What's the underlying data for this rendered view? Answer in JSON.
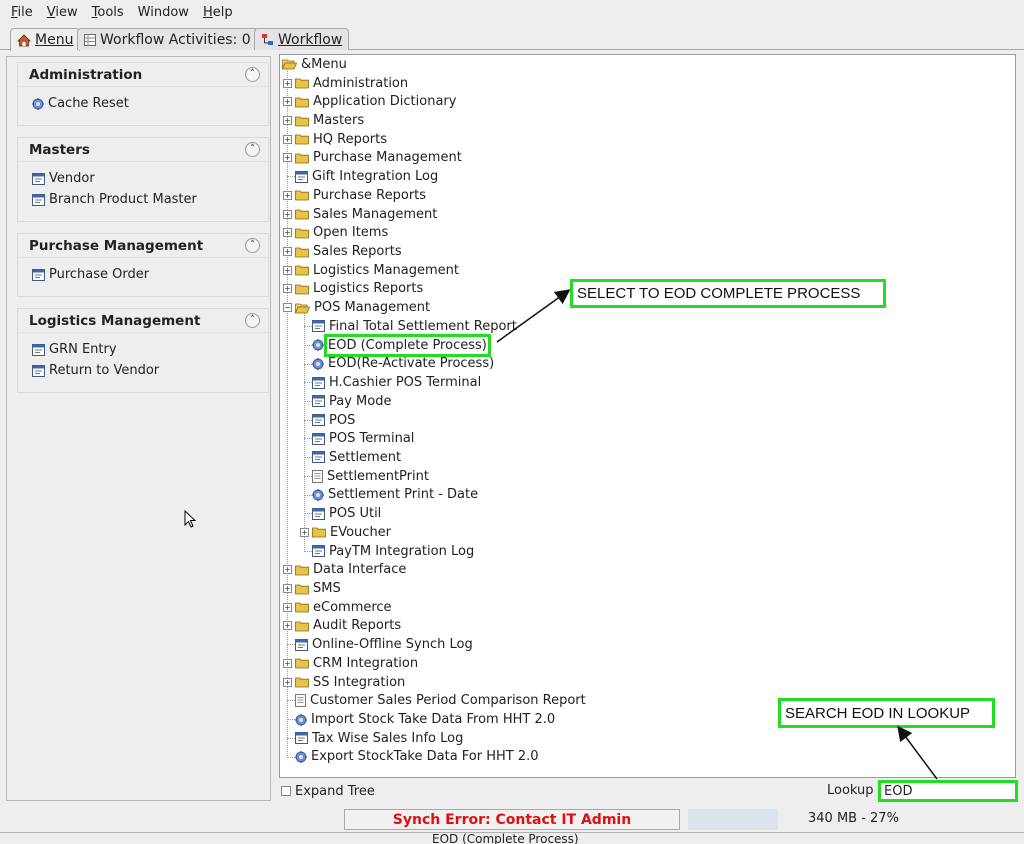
{
  "menubar": [
    {
      "pre": "",
      "ul": "F",
      "post": "ile"
    },
    {
      "pre": "",
      "ul": "V",
      "post": "iew"
    },
    {
      "pre": "",
      "ul": "T",
      "post": "ools"
    },
    {
      "pre": "Window",
      "ul": "",
      "post": ""
    },
    {
      "pre": "",
      "ul": "H",
      "post": "elp"
    }
  ],
  "tabs": {
    "menu": "Menu",
    "workflow_activities": "Workflow Activities: 0",
    "workflow": "Workflow"
  },
  "sidebar": [
    {
      "title": "Administration",
      "items": [
        {
          "label": "Cache Reset",
          "icon": "process-gear-icon"
        }
      ]
    },
    {
      "title": "Masters",
      "items": [
        {
          "label": "Vendor",
          "icon": "window-icon"
        },
        {
          "label": "Branch Product Master",
          "icon": "window-icon"
        }
      ]
    },
    {
      "title": "Purchase Management",
      "items": [
        {
          "label": "Purchase Order",
          "icon": "window-icon"
        }
      ]
    },
    {
      "title": "Logistics Management",
      "items": [
        {
          "label": "GRN Entry",
          "icon": "window-icon"
        },
        {
          "label": "Return to Vendor",
          "icon": "window-icon"
        }
      ]
    }
  ],
  "tree": {
    "root": "&Menu",
    "nodes": [
      {
        "label": "Administration",
        "type": "folder",
        "level": 1,
        "expand": "+"
      },
      {
        "label": "Application Dictionary",
        "type": "folder",
        "level": 1,
        "expand": "+"
      },
      {
        "label": "Masters",
        "type": "folder",
        "level": 1,
        "expand": "+"
      },
      {
        "label": "HQ Reports",
        "type": "folder",
        "level": 1,
        "expand": "+"
      },
      {
        "label": "Purchase Management",
        "type": "folder",
        "level": 1,
        "expand": "+"
      },
      {
        "label": "Gift Integration Log",
        "type": "window",
        "level": 1,
        "expand": ""
      },
      {
        "label": "Purchase Reports",
        "type": "folder",
        "level": 1,
        "expand": "+"
      },
      {
        "label": "Sales Management",
        "type": "folder",
        "level": 1,
        "expand": "+"
      },
      {
        "label": "Open Items",
        "type": "folder",
        "level": 1,
        "expand": "+"
      },
      {
        "label": "Sales Reports",
        "type": "folder",
        "level": 1,
        "expand": "+"
      },
      {
        "label": "Logistics Management",
        "type": "folder",
        "level": 1,
        "expand": "+"
      },
      {
        "label": "Logistics Reports",
        "type": "folder",
        "level": 1,
        "expand": "+"
      },
      {
        "label": "POS Management",
        "type": "folder-open",
        "level": 1,
        "expand": "-"
      },
      {
        "label": "Final Total Settlement Report",
        "type": "window",
        "level": 2,
        "expand": ""
      },
      {
        "label": "EOD (Complete Process)",
        "type": "process",
        "level": 2,
        "expand": "",
        "highlight": true
      },
      {
        "label": "EOD(Re-Activate Process)",
        "type": "process",
        "level": 2,
        "expand": ""
      },
      {
        "label": "H.Cashier POS Terminal",
        "type": "window",
        "level": 2,
        "expand": ""
      },
      {
        "label": "Pay Mode",
        "type": "window",
        "level": 2,
        "expand": ""
      },
      {
        "label": "POS",
        "type": "window",
        "level": 2,
        "expand": ""
      },
      {
        "label": "POS Terminal",
        "type": "window",
        "level": 2,
        "expand": ""
      },
      {
        "label": "Settlement",
        "type": "window",
        "level": 2,
        "expand": ""
      },
      {
        "label": "SettlementPrint",
        "type": "report",
        "level": 2,
        "expand": ""
      },
      {
        "label": "Settlement Print - Date",
        "type": "process",
        "level": 2,
        "expand": ""
      },
      {
        "label": "POS Util",
        "type": "window",
        "level": 2,
        "expand": ""
      },
      {
        "label": "EVoucher",
        "type": "folder",
        "level": 2,
        "expand": "+"
      },
      {
        "label": "PayTM Integration Log",
        "type": "window",
        "level": 2,
        "expand": ""
      },
      {
        "label": "Data Interface",
        "type": "folder",
        "level": 1,
        "expand": "+"
      },
      {
        "label": "SMS",
        "type": "folder",
        "level": 1,
        "expand": "+"
      },
      {
        "label": "eCommerce",
        "type": "folder",
        "level": 1,
        "expand": "+"
      },
      {
        "label": "Audit Reports",
        "type": "folder",
        "level": 1,
        "expand": "+"
      },
      {
        "label": "Online-Offline Synch Log",
        "type": "window",
        "level": 1,
        "expand": ""
      },
      {
        "label": "CRM Integration",
        "type": "folder",
        "level": 1,
        "expand": "+"
      },
      {
        "label": "SS Integration",
        "type": "folder",
        "level": 1,
        "expand": "+"
      },
      {
        "label": "Customer Sales Period Comparison Report",
        "type": "report",
        "level": 1,
        "expand": ""
      },
      {
        "label": "Import Stock Take Data From HHT 2.0",
        "type": "process",
        "level": 1,
        "expand": ""
      },
      {
        "label": "Tax Wise Sales Info Log",
        "type": "window",
        "level": 1,
        "expand": ""
      },
      {
        "label": "Export StockTake Data For HHT 2.0",
        "type": "process",
        "level": 1,
        "expand": ""
      }
    ]
  },
  "expand_tree_label": "Expand Tree",
  "lookup": {
    "label": "Lookup",
    "value": "EOD"
  },
  "status": {
    "error": "Synch Error: Contact IT Admin",
    "memory": "340 MB - 27%",
    "bottom": "EOD (Complete Process)"
  },
  "annotations": {
    "select": "SELECT TO EOD COMPLETE PROCESS",
    "search": "SEARCH EOD IN LOOKUP"
  },
  "colors": {
    "highlight_green": "#22dd22",
    "error_red": "#e01010",
    "folder_yellow": "#e8c34a"
  }
}
